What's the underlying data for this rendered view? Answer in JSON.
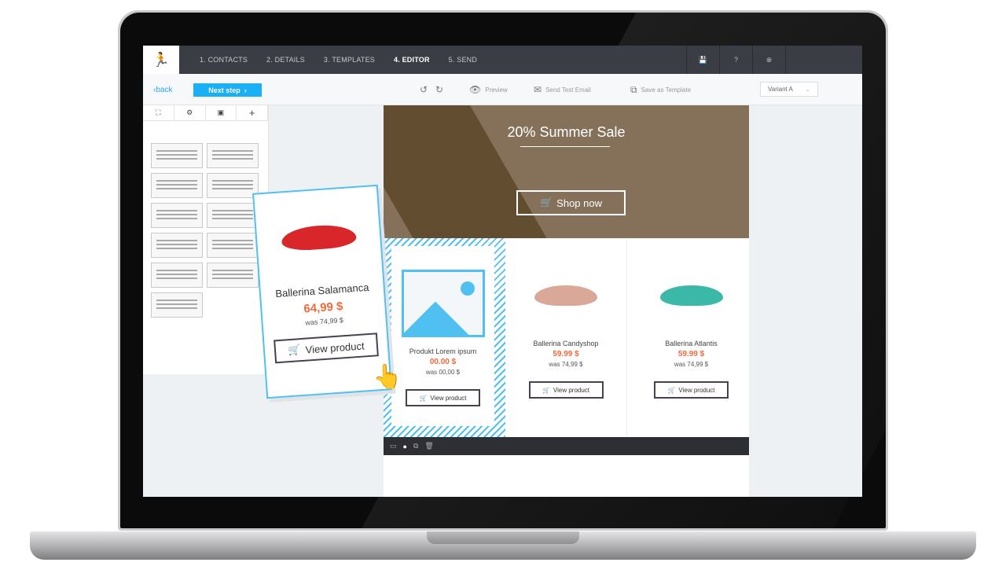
{
  "nav": {
    "steps": [
      "1. CONTACTS",
      "2. DETAILS",
      "3. TEMPLATES",
      "4. EDITOR",
      "5. SEND"
    ],
    "active": 3,
    "icons": [
      "save-icon",
      "help-icon",
      "close-icon"
    ]
  },
  "toolbar": {
    "back": "back",
    "next": "Next step",
    "preview": "Preview",
    "send_test": "Send Test Email",
    "save_template": "Save as Template",
    "variant": "Variant A"
  },
  "sidebar": {
    "tabs": [
      "structure-icon",
      "gear-icon",
      "image-icon",
      "plus-icon"
    ]
  },
  "hero": {
    "title": "20% Summer Sale",
    "button": "Shop now"
  },
  "products": [
    {
      "name": "Produkt Lorem ipsum",
      "price": "00.00 $",
      "was": "was  00,00 $",
      "button": "View product"
    },
    {
      "name": "Ballerina Candyshop",
      "price": "59.99 $",
      "was": "was 74,99 $",
      "button": "View product",
      "color": "#d9a898"
    },
    {
      "name": "Ballerina Atlantis",
      "price": "59.99 $",
      "was": "was 74,99 $",
      "button": "View product",
      "color": "#3bb8a8"
    }
  ],
  "drag_card": {
    "name": "Ballerina Salamanca",
    "price": "64,99 $",
    "was": "was 74,99 $",
    "button": "View product",
    "color": "#d8262a"
  },
  "colors": {
    "accent": "#19b0f5",
    "price": "#ef6a3c",
    "hero": "#85715a"
  }
}
